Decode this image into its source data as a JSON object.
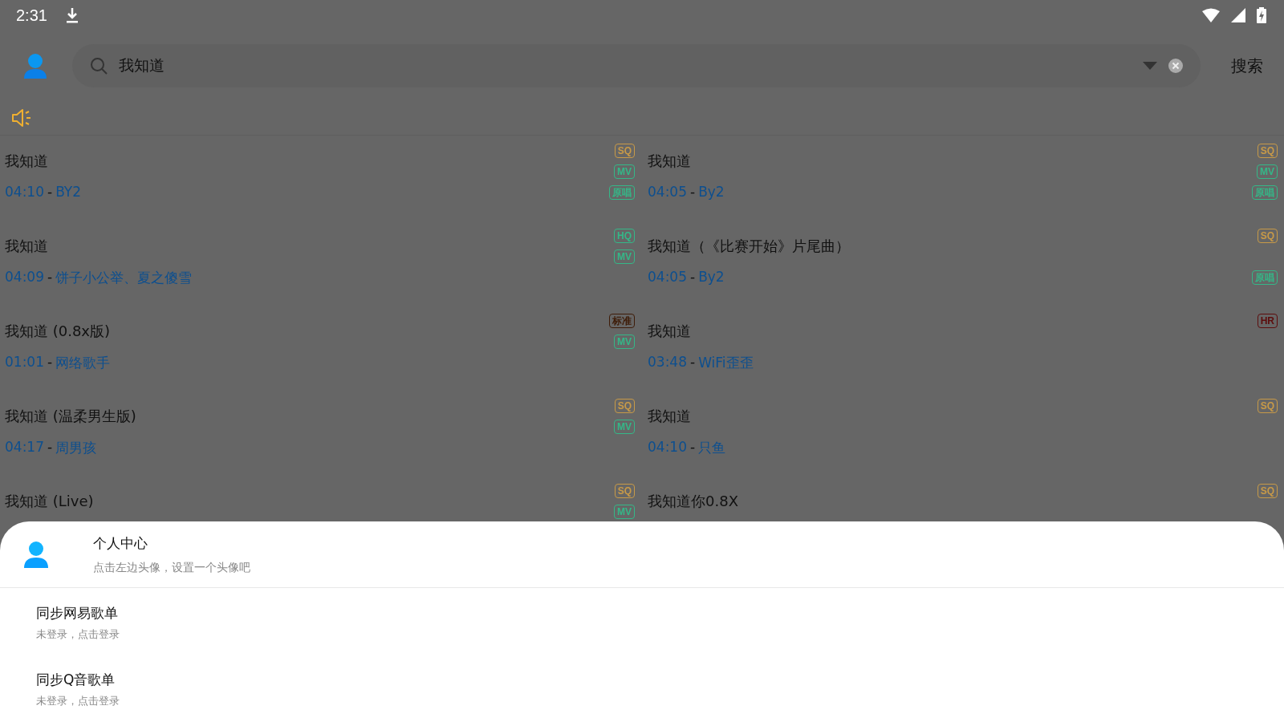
{
  "status_bar": {
    "time": "2:31"
  },
  "search": {
    "value": "我知道",
    "button": "搜索"
  },
  "songs_separator": "-",
  "songs": [
    {
      "title": "我知道",
      "duration": "04:10",
      "artist": "BY2",
      "badges": [
        {
          "label": "SQ",
          "kind": "quality",
          "color": "#c89a48"
        },
        {
          "label": "MV",
          "kind": "mv",
          "color": "#34b888"
        },
        {
          "label": "原唱",
          "kind": "original",
          "color": "#34b888"
        }
      ]
    },
    {
      "title": "我知道",
      "duration": "04:05",
      "artist": "By2",
      "badges": [
        {
          "label": "SQ",
          "kind": "quality",
          "color": "#c89a48"
        },
        {
          "label": "MV",
          "kind": "mv",
          "color": "#34b888"
        },
        {
          "label": "原唱",
          "kind": "original",
          "color": "#34b888"
        }
      ]
    },
    {
      "title": "我知道",
      "duration": "04:09",
      "artist": "饼子小公举、夏之傻雪",
      "badges": [
        {
          "label": "HQ",
          "kind": "quality",
          "color": "#34b888"
        },
        {
          "label": "MV",
          "kind": "mv",
          "color": "#34b888"
        }
      ]
    },
    {
      "title": "我知道（《比赛开始》片尾曲）",
      "duration": "04:05",
      "artist": "By2",
      "badges": [
        {
          "label": "SQ",
          "kind": "quality",
          "color": "#c89a48"
        },
        {
          "label": "原唱",
          "kind": "original",
          "color": "#34b888"
        }
      ]
    },
    {
      "title": "我知道 (0.8x版)",
      "duration": "01:01",
      "artist": "网络歌手",
      "badges": [
        {
          "label": "标准",
          "kind": "quality",
          "color": "#3e1c08"
        },
        {
          "label": "MV",
          "kind": "mv",
          "color": "#34b888"
        }
      ]
    },
    {
      "title": "我知道",
      "duration": "03:48",
      "artist": "WiFi歪歪",
      "badges": [
        {
          "label": "HR",
          "kind": "quality",
          "color": "#5c0c0c"
        }
      ]
    },
    {
      "title": "我知道 (温柔男生版)",
      "duration": "04:17",
      "artist": "周男孩",
      "badges": [
        {
          "label": "SQ",
          "kind": "quality",
          "color": "#c89a48"
        },
        {
          "label": "MV",
          "kind": "mv",
          "color": "#34b888"
        }
      ]
    },
    {
      "title": "我知道",
      "duration": "04:10",
      "artist": "只鱼",
      "badges": [
        {
          "label": "SQ",
          "kind": "quality",
          "color": "#c89a48"
        }
      ]
    },
    {
      "title": "我知道 (Live)",
      "badges": [
        {
          "label": "SQ",
          "kind": "quality",
          "color": "#c89a48"
        },
        {
          "label": "MV",
          "kind": "mv",
          "color": "#34b888"
        }
      ]
    },
    {
      "title": "我知道你0.8X",
      "badges": [
        {
          "label": "SQ",
          "kind": "quality",
          "color": "#c89a48"
        }
      ]
    }
  ],
  "sheet": {
    "profile": {
      "title": "个人中心",
      "subtitle": "点击左边头像，设置一个头像吧"
    },
    "items": [
      {
        "title": "同步网易歌单",
        "subtitle": "未登录，点击登录"
      },
      {
        "title": "同步Q音歌单",
        "subtitle": "未登录，点击登录"
      }
    ]
  }
}
